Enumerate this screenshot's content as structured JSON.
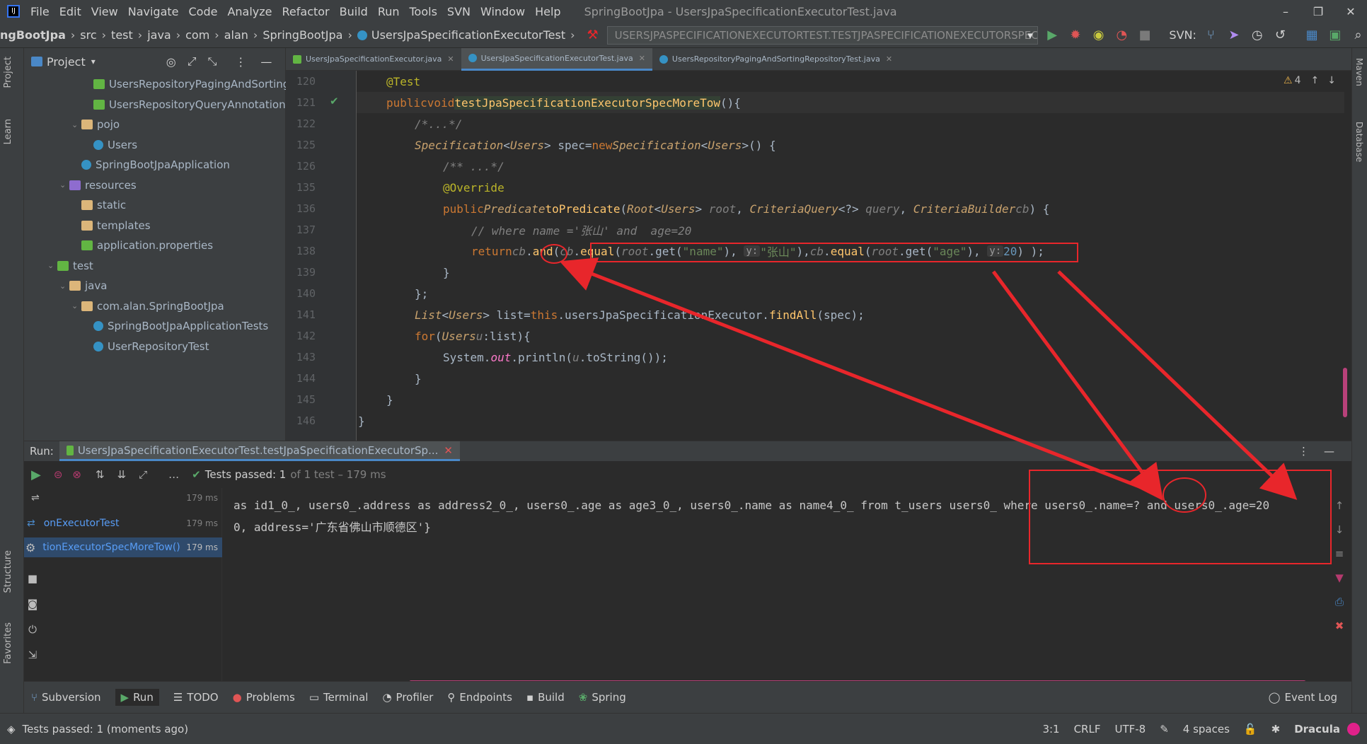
{
  "window": {
    "title": "SpringBootJpa - UsersJpaSpecificationExecutorTest.java"
  },
  "menu": [
    "File",
    "Edit",
    "View",
    "Navigate",
    "Code",
    "Analyze",
    "Refactor",
    "Build",
    "Run",
    "Tools",
    "SVN",
    "Window",
    "Help"
  ],
  "breadcrumb": [
    "ngBootJpa",
    "src",
    "test",
    "java",
    "com",
    "alan",
    "SpringBootJpa",
    "UsersJpaSpecificationExecutorTest"
  ],
  "run_config": "USERSJPASPECIFICATIONEXECUTORTEST.TESTJPASPECIFICATIONEXECUTORSPECMORETOW",
  "svn_label": "SVN:",
  "left_tabs": [
    "Project",
    "Learn",
    "Structure",
    "Favorites"
  ],
  "right_tabs": [
    "Maven",
    "Database"
  ],
  "project": {
    "header": "Project",
    "tree": [
      {
        "label": "UsersRepositoryPagingAndSorting",
        "icon": "interface-icon",
        "indent": 2
      },
      {
        "label": "UsersRepositoryQueryAnnotation",
        "icon": "interface-icon",
        "indent": 2
      },
      {
        "label": "pojo",
        "icon": "folder-icon",
        "indent": 1,
        "expanded": true
      },
      {
        "label": "Users",
        "icon": "class-icon",
        "indent": 2
      },
      {
        "label": "SpringBootJpaApplication",
        "icon": "class-icon",
        "indent": 1
      },
      {
        "label": "resources",
        "icon": "resources-folder-icon",
        "indent": 0,
        "expanded": true
      },
      {
        "label": "static",
        "icon": "folder-icon",
        "indent": 1
      },
      {
        "label": "templates",
        "icon": "folder-icon",
        "indent": 1
      },
      {
        "label": "application.properties",
        "icon": "properties-icon",
        "indent": 1
      },
      {
        "label": "test",
        "icon": "test-folder-icon",
        "indent": -1,
        "expanded": true
      },
      {
        "label": "java",
        "icon": "folder-icon",
        "indent": 0,
        "expanded": true
      },
      {
        "label": "com.alan.SpringBootJpa",
        "icon": "package-icon",
        "indent": 1,
        "expanded": true
      },
      {
        "label": "SpringBootJpaApplicationTests",
        "icon": "class-icon",
        "indent": 2
      },
      {
        "label": "UserRepositoryTest",
        "icon": "class-icon",
        "indent": 2
      }
    ]
  },
  "editor_tabs": [
    {
      "label": "UsersJpaSpecificationExecutor.java",
      "active": false
    },
    {
      "label": "UsersJpaSpecificationExecutorTest.java",
      "active": true
    },
    {
      "label": "UsersRepositoryPagingAndSortingRepositoryTest.java",
      "active": false
    }
  ],
  "warnings": "4",
  "line_numbers": [
    "120",
    "121",
    "122",
    "125",
    "126",
    "135",
    "136",
    "137",
    "138",
    "139",
    "140",
    "141",
    "142",
    "143",
    "144",
    "145",
    "146"
  ],
  "run": {
    "label": "Run:",
    "tab": "UsersJpaSpecificationExecutorTest.testJpaSpecificationExecutorSp...",
    "tests_passed": "Tests passed: 1",
    "tests_detail": "of 1 test – 179 ms",
    "tree": [
      {
        "label": "",
        "ms": "179 ms"
      },
      {
        "label": "onExecutorTest",
        "ms": "179 ms"
      },
      {
        "label": "tionExecutorSpecMoreTow()",
        "ms": "179 ms"
      }
    ],
    "console": [
      "as id1_0_, users0_.address as address2_0_, users0_.age as age3_0_, users0_.name as name4_0_ from t_users users0_ where users0_.name=? and users0_.age=20",
      "0, address='广东省佛山市顺德区'}"
    ]
  },
  "tool_windows": [
    "Subversion",
    "Run",
    "TODO",
    "Problems",
    "Terminal",
    "Profiler",
    "Endpoints",
    "Build",
    "Spring"
  ],
  "event_log": "Event Log",
  "status": {
    "message": "Tests passed: 1 (moments ago)",
    "position": "3:1",
    "line_sep": "CRLF",
    "encoding": "UTF-8",
    "indent": "4 spaces",
    "theme": "Dracula"
  },
  "colors": {
    "annotation_red": "#e8262b",
    "accent": "#4a88c7"
  }
}
